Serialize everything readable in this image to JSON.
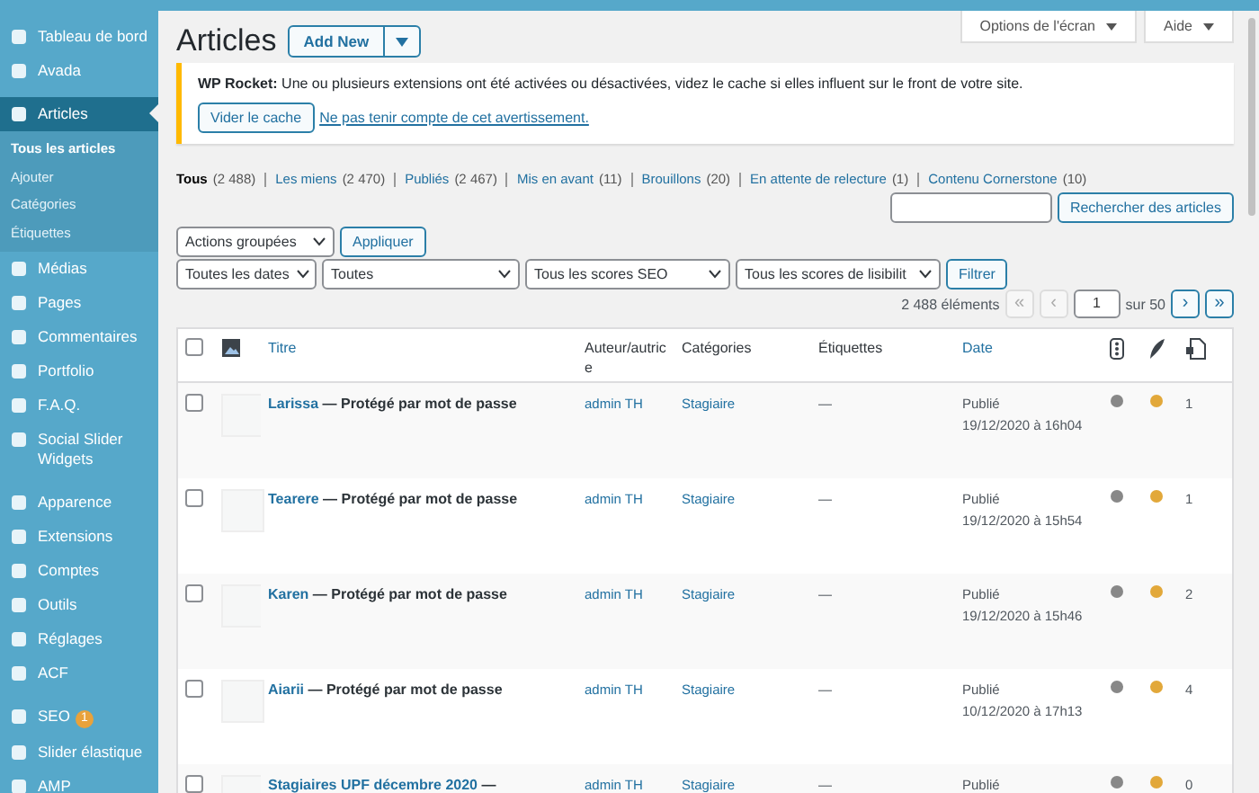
{
  "sidebar": {
    "items": [
      {
        "label": "Tableau de bord",
        "selected": false
      },
      {
        "label": "Avada",
        "selected": false
      },
      {
        "label": "Articles",
        "selected": true,
        "children": [
          {
            "label": "Tous les articles",
            "selected": true
          },
          {
            "label": "Ajouter",
            "selected": false
          },
          {
            "label": "Catégories",
            "selected": false
          },
          {
            "label": "Étiquettes",
            "selected": false
          }
        ]
      },
      {
        "label": "Médias",
        "selected": false
      },
      {
        "label": "Pages",
        "selected": false
      },
      {
        "label": "Commentaires",
        "selected": false
      },
      {
        "label": "Portfolio",
        "selected": false
      },
      {
        "label": "F.A.Q.",
        "selected": false
      },
      {
        "label": "Social Slider Widgets",
        "selected": false
      },
      {
        "label": "Apparence",
        "selected": false
      },
      {
        "label": "Extensions",
        "selected": false
      },
      {
        "label": "Comptes",
        "selected": false
      },
      {
        "label": "Outils",
        "selected": false
      },
      {
        "label": "Réglages",
        "selected": false
      },
      {
        "label": "ACF",
        "selected": false
      },
      {
        "label": "SEO",
        "selected": false,
        "badge": "1"
      },
      {
        "label": "Slider élastique",
        "selected": false
      },
      {
        "label": "AMP",
        "selected": false
      }
    ]
  },
  "header": {
    "title": "Articles",
    "add_new": "Add New",
    "screen_options": "Options de l'écran",
    "help": "Aide"
  },
  "notice": {
    "text": "**WP Rocket:** Une ou plusieurs extensions ont été activées ou désactivées, videz le cache si elles influent sur le front de votre site.",
    "button": "Vider le cache",
    "dismiss_link": "Ne pas tenir compte de cet avertissement."
  },
  "views": [
    {
      "label": "Tous",
      "count": "(2 488)",
      "selected": true
    },
    {
      "label": "Les miens",
      "count": "(2 470)",
      "selected": false
    },
    {
      "label": "Publiés",
      "count": "(2 467)",
      "selected": false
    },
    {
      "label": "Mis en avant",
      "count": "(11)",
      "selected": false
    },
    {
      "label": "Brouillons",
      "count": "(20)",
      "selected": false
    },
    {
      "label": "En attente de relecture",
      "count": "(1)",
      "selected": false
    },
    {
      "label": "Contenu Cornerstone",
      "count": "(10)",
      "selected": false
    }
  ],
  "search": {
    "button": "Rechercher des articles"
  },
  "bulk_actions": {
    "select": "Actions groupées",
    "apply": "Appliquer"
  },
  "filters": {
    "selects": [
      "Toutes les dates",
      "Toutes",
      "Tous les scores SEO",
      "Tous les scores de lisibilit"
    ],
    "button": "Filtrer"
  },
  "pagination": {
    "count": "2 488 éléments",
    "first": {
      "label": "«",
      "disabled": true
    },
    "prev": {
      "label": "‹",
      "disabled": true
    },
    "page": "1",
    "total": "sur 50",
    "next": {
      "label": "›",
      "disabled": false
    },
    "last": {
      "label": "»",
      "disabled": false
    }
  },
  "table": {
    "columns": [
      {
        "kind": "checkbox",
        "checked": false
      },
      {
        "kind": "image"
      },
      {
        "kind": "text",
        "label": "Titre",
        "sortable": true
      },
      {
        "kind": "text",
        "label": "Auteur/autrice",
        "sortable": false
      },
      {
        "kind": "text",
        "label": "Catégories",
        "sortable": false
      },
      {
        "kind": "text",
        "label": "Étiquettes",
        "sortable": false
      },
      {
        "kind": "text",
        "label": "Date",
        "sortable": true
      },
      {
        "kind": "seo"
      },
      {
        "kind": "readability"
      },
      {
        "kind": "links"
      }
    ],
    "rows": [
      {
        "checked": false,
        "title": "Larissa",
        "state": "— Protégé par mot de passe",
        "author": "admin TH",
        "category": "Stagiaire",
        "tags": "—",
        "status": "Publié",
        "date": "19/12/2020 à 16h04",
        "links": "1"
      },
      {
        "checked": false,
        "title": "Tearere",
        "state": "— Protégé par mot de passe",
        "author": "admin TH",
        "category": "Stagiaire",
        "tags": "—",
        "status": "Publié",
        "date": "19/12/2020 à 15h54",
        "links": "1"
      },
      {
        "checked": false,
        "title": "Karen",
        "state": "— Protégé par mot de passe",
        "author": "admin TH",
        "category": "Stagiaire",
        "tags": "—",
        "status": "Publié",
        "date": "19/12/2020 à 15h46",
        "links": "2"
      },
      {
        "checked": false,
        "title": "Aiarii",
        "state": "— Protégé par mot de passe",
        "author": "admin TH",
        "category": "Stagiaire",
        "tags": "—",
        "status": "Publié",
        "date": "10/12/2020 à 17h13",
        "links": "4"
      },
      {
        "checked": false,
        "title": "Stagiaires UPF décembre 2020",
        "state": "—",
        "author": "admin TH",
        "category": "Stagiaire",
        "tags": "—",
        "status": "Publié",
        "links": "0"
      }
    ]
  }
}
